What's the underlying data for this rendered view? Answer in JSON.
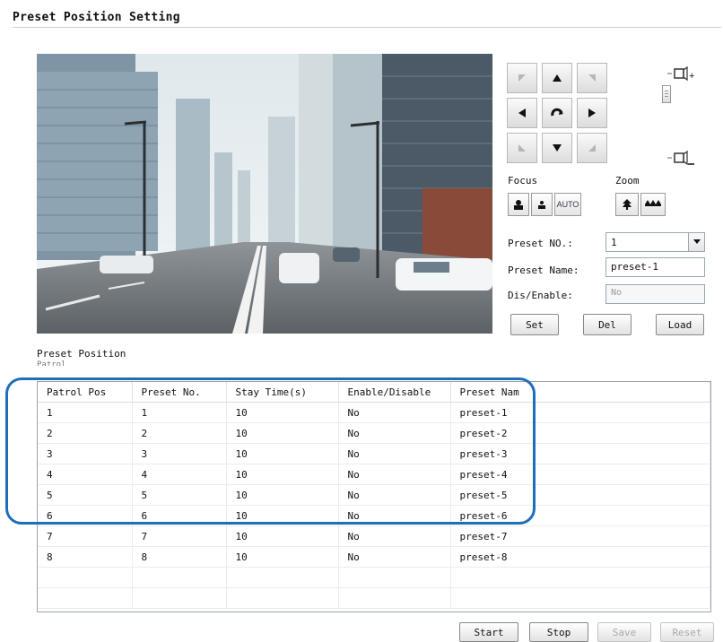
{
  "title": "Preset Position Setting",
  "controls": {
    "focus_label": "Focus",
    "zoom_label": "Zoom",
    "focus_auto": "AUTO",
    "preset_no_label": "Preset NO.:",
    "preset_no_value": "1",
    "preset_name_label": "Preset Name:",
    "preset_name_value": "preset-1",
    "dis_enable_label": "Dis/Enable:",
    "dis_enable_value": "No",
    "set": "Set",
    "del": "Del",
    "load": "Load"
  },
  "section": {
    "title": "Preset Position",
    "subtitle": "Patrol"
  },
  "table": {
    "headers": [
      "Patrol Pos",
      "Preset No.",
      "Stay Time(s)",
      "Enable/Disable",
      "Preset Nam"
    ],
    "rows": [
      [
        "1",
        "1",
        "10",
        "No",
        "preset-1"
      ],
      [
        "2",
        "2",
        "10",
        "No",
        "preset-2"
      ],
      [
        "3",
        "3",
        "10",
        "No",
        "preset-3"
      ],
      [
        "4",
        "4",
        "10",
        "No",
        "preset-4"
      ],
      [
        "5",
        "5",
        "10",
        "No",
        "preset-5"
      ],
      [
        "6",
        "6",
        "10",
        "No",
        "preset-6"
      ],
      [
        "7",
        "7",
        "10",
        "No",
        "preset-7"
      ],
      [
        "8",
        "8",
        "10",
        "No",
        "preset-8"
      ]
    ]
  },
  "footer": {
    "start": "Start",
    "stop": "Stop",
    "save": "Save",
    "reset": "Reset"
  },
  "colors": {
    "highlight": "#1f6fb8"
  },
  "icons": {
    "ptz": [
      "arrow-up-left-icon",
      "arrow-up-icon",
      "arrow-up-right-icon",
      "arrow-left-icon",
      "rotate-icon",
      "arrow-right-icon",
      "arrow-down-left-icon",
      "arrow-down-icon",
      "arrow-down-right-icon"
    ],
    "zoom": [
      "zoom-in-icon",
      "zoom-out-icon"
    ],
    "focus": [
      "focus-near-icon",
      "focus-far-icon"
    ],
    "zoom_buttons": [
      "zoom-tele-icon",
      "zoom-wide-icon"
    ]
  }
}
